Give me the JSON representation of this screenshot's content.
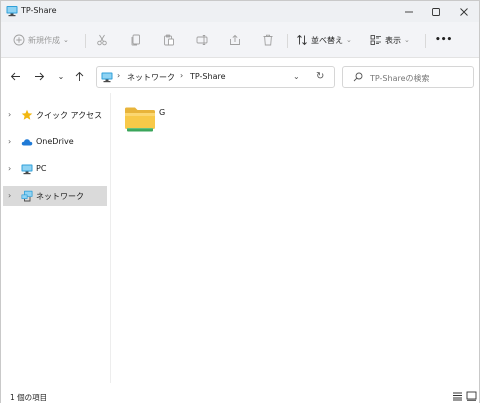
{
  "window": {
    "title": "TP-Share"
  },
  "toolbar": {
    "new_label": "新規作成",
    "sort_label": "並べ替え",
    "view_label": "表示",
    "more_label": "•••"
  },
  "address": {
    "crumbs": [
      "ネットワーク",
      "TP-Share"
    ],
    "search_placeholder": "TP-Shareの検索"
  },
  "sidebar": {
    "items": [
      {
        "label": "クイック アクセス",
        "icon": "star-icon"
      },
      {
        "label": "OneDrive",
        "icon": "cloud-icon"
      },
      {
        "label": "PC",
        "icon": "pc-icon"
      },
      {
        "label": "ネットワーク",
        "icon": "network-icon",
        "selected": true
      }
    ]
  },
  "content": {
    "items": [
      {
        "name": "G",
        "type": "folder"
      }
    ]
  },
  "status": {
    "item_count": "1 個の項目"
  },
  "colors": {
    "accent": "#0067c0",
    "folder_yellow": "#f8c948",
    "folder_green": "#3aa55a",
    "selected_bg": "#dadada"
  }
}
